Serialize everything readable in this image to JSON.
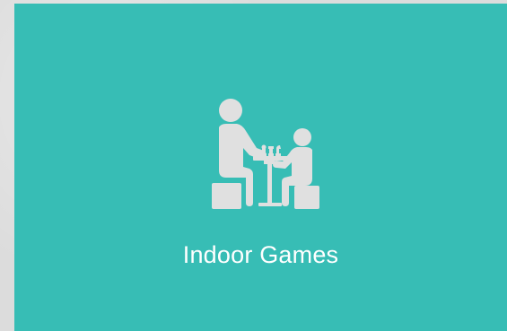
{
  "card": {
    "label": "Indoor Games",
    "icon": "chess-players-icon",
    "background_color": "#37bdb5",
    "icon_color": "#e0e0e0",
    "text_color": "#ffffff"
  }
}
